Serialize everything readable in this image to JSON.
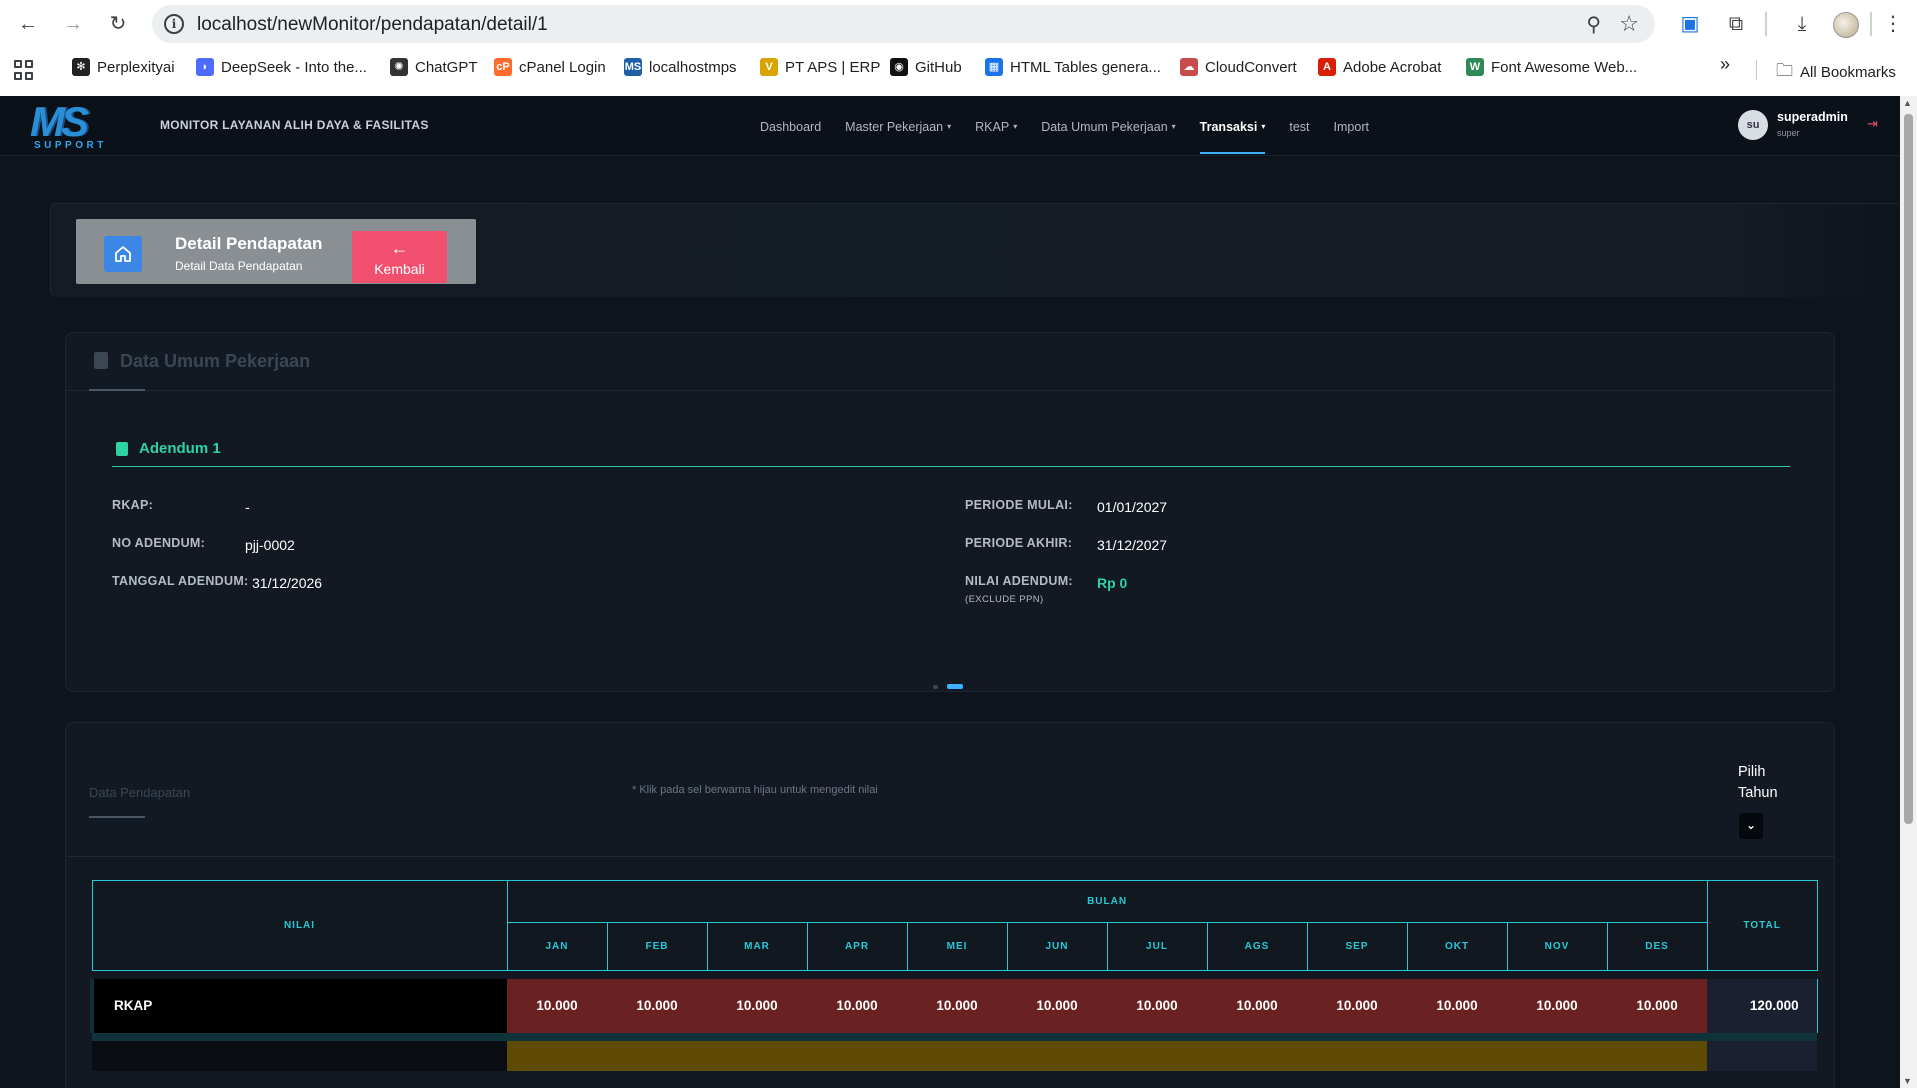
{
  "browser": {
    "url": "localhost/newMonitor/pendapatan/detail/1",
    "bookmarks": [
      {
        "label": "Perplexityai",
        "color": "#222222",
        "glyph": "✻"
      },
      {
        "label": "DeepSeek - Into the...",
        "color": "#4d6bfe",
        "glyph": "◗"
      },
      {
        "label": "ChatGPT",
        "color": "#333333",
        "glyph": "✺"
      },
      {
        "label": "cPanel Login",
        "color": "#ff6c2c",
        "glyph": "cP"
      },
      {
        "label": "localhostmps",
        "color": "#1f5fa8",
        "glyph": "MS"
      },
      {
        "label": "PT APS | ERP",
        "color": "#d9a400",
        "glyph": "V"
      },
      {
        "label": "GitHub",
        "color": "#111111",
        "glyph": "◉"
      },
      {
        "label": "HTML Tables genera...",
        "color": "#1a73e8",
        "glyph": "▦"
      },
      {
        "label": "CloudConvert",
        "color": "#c94c4c",
        "glyph": "☁"
      },
      {
        "label": "Adobe Acrobat",
        "color": "#d81e05",
        "glyph": "A"
      },
      {
        "label": "Font Awesome Web...",
        "color": "#2e8b57",
        "glyph": "W"
      }
    ],
    "all_bookmarks": "All Bookmarks",
    "overflow": "»"
  },
  "app": {
    "logo_big": "MS",
    "logo_small": "SUPPORT",
    "title": "MONITOR LAYANAN ALIH DAYA & FASILITAS",
    "menu": [
      {
        "label": "Dashboard",
        "dropdown": false,
        "active": false
      },
      {
        "label": "Master Pekerjaan",
        "dropdown": true,
        "active": false
      },
      {
        "label": "RKAP",
        "dropdown": true,
        "active": false
      },
      {
        "label": "Data Umum Pekerjaan",
        "dropdown": true,
        "active": false
      },
      {
        "label": "Transaksi",
        "dropdown": true,
        "active": true
      },
      {
        "label": "test",
        "dropdown": false,
        "active": false
      },
      {
        "label": "Import",
        "dropdown": false,
        "active": false
      }
    ],
    "user": {
      "initials": "su",
      "name": "superadmin",
      "role": "super"
    }
  },
  "hero": {
    "title": "Detail Pendapatan",
    "subtitle": "Detail Data Pendapatan",
    "back_label": "Kembali"
  },
  "data_umum": {
    "title": "Data Umum Pekerjaan",
    "adendum_title": "Adendum 1",
    "left": [
      {
        "label": "RKAP:",
        "value": "-"
      },
      {
        "label": "NO ADENDUM:",
        "value": "pjj-0002"
      },
      {
        "label": "TANGGAL ADENDUM:",
        "value": "31/12/2026"
      }
    ],
    "right": [
      {
        "label": "PERIODE MULAI:",
        "value": "01/01/2027"
      },
      {
        "label": "PERIODE AKHIR:",
        "value": "31/12/2027"
      },
      {
        "label": "NILAI ADENDUM:",
        "value": "Rp 0",
        "note": "(EXCLUDE PPN)"
      }
    ]
  },
  "pendapatan": {
    "title": "Data Pendapatan",
    "hint": "* Klik pada sel berwarna hijau untuk mengedit nilai",
    "year_label": "Pilih Tahun",
    "table": {
      "h_nilai": "NILAI",
      "h_bulan": "BULAN",
      "h_total": "TOTAL",
      "months": [
        "JAN",
        "FEB",
        "MAR",
        "APR",
        "MEI",
        "JUN",
        "JUL",
        "AGS",
        "SEP",
        "OKT",
        "NOV",
        "DES"
      ],
      "rows": [
        {
          "name": "RKAP",
          "values": [
            "10.000",
            "10.000",
            "10.000",
            "10.000",
            "10.000",
            "10.000",
            "10.000",
            "10.000",
            "10.000",
            "10.000",
            "10.000",
            "10.000"
          ],
          "total": "120.000"
        }
      ]
    }
  },
  "colors": {
    "accent": "#28c9d6",
    "green": "#2ed3a1",
    "danger": "#f0506e",
    "rkap_cell": "#6a2121",
    "row2_cell": "#5e4a00"
  }
}
